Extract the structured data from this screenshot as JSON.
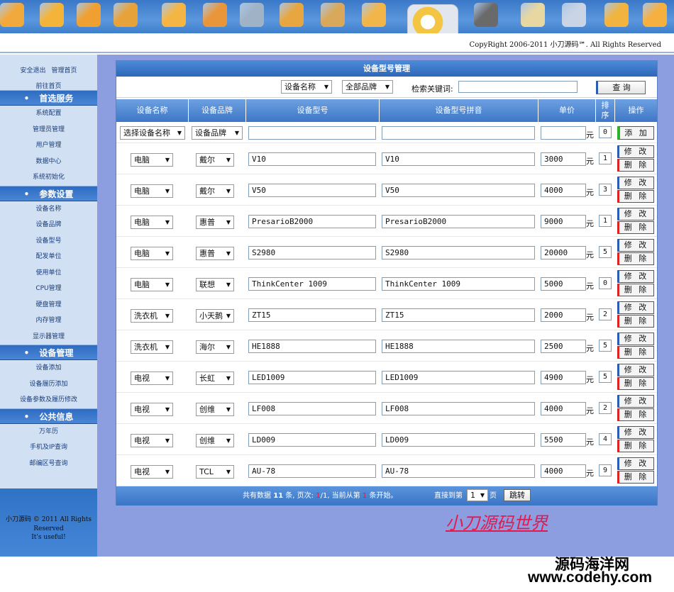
{
  "copyright": "CopyRight 2006-2011 小刀源码℠. All Rights Reserved",
  "toolbar_icons": [
    "home-icon",
    "tools-icon",
    "user-icon",
    "users-icon",
    "ai-icon",
    "briefcase-icon",
    "network-icon",
    "calculator-icon",
    "grid-icon",
    "image-edit-icon",
    "featured-icon",
    "clapperboard-icon",
    "package-icon",
    "calendar-icon",
    "coupon-icon",
    "clock-icon"
  ],
  "sidebar": {
    "quick_links": [
      "安全退出",
      "管理首页"
    ],
    "front_link": "前往首页",
    "sections": [
      {
        "title": "首选服务",
        "items": [
          "系统配置",
          "管理员管理",
          "用户管理",
          "数据中心",
          "系统初始化"
        ]
      },
      {
        "title": "参数设置",
        "items": [
          "设备名称",
          "设备品牌",
          "设备型号",
          "配发单位",
          "使用单位",
          "CPU管理",
          "硬盘管理",
          "内存管理",
          "显示器管理"
        ]
      },
      {
        "title": "设备管理",
        "items": [
          "设备添加",
          "设备履历添加",
          "设备参数及履历修改"
        ]
      },
      {
        "title": "公共信息",
        "items": [
          "万年历",
          "手机及IP查询",
          "邮编区号查询"
        ]
      }
    ],
    "footer": [
      "小刀源码 © 2011 All Rights",
      "Reserved",
      "It's useful!"
    ]
  },
  "panel": {
    "title": "设备型号管理",
    "filter_name": "设备名称",
    "filter_brand": "全部品牌",
    "search_label": "检索关键词:",
    "search_value": "",
    "search_button": "查 询"
  },
  "columns": [
    "设备名称",
    "设备品牌",
    "设备型号",
    "设备型号拼音",
    "单价",
    "排序",
    "操作"
  ],
  "add_row": {
    "name": "选择设备名称",
    "brand": "设备品牌",
    "model": "",
    "pinyin": "",
    "price": "",
    "unit": "元",
    "order": "0",
    "button": "添 加"
  },
  "rows": [
    {
      "name": "电脑",
      "brand": "戴尔",
      "model": "V10",
      "pinyin": "V10",
      "price": "3000",
      "order": "1"
    },
    {
      "name": "电脑",
      "brand": "戴尔",
      "model": "V50",
      "pinyin": "V50",
      "price": "4000",
      "order": "3"
    },
    {
      "name": "电脑",
      "brand": "惠普",
      "model": "PresarioB2000",
      "pinyin": "PresarioB2000",
      "price": "9000",
      "order": "1"
    },
    {
      "name": "电脑",
      "brand": "惠普",
      "model": "S2980",
      "pinyin": "S2980",
      "price": "20000",
      "order": "5"
    },
    {
      "name": "电脑",
      "brand": "联想",
      "model": "ThinkCenter 1009",
      "pinyin": "ThinkCenter 1009",
      "price": "5000",
      "order": "0"
    },
    {
      "name": "洗衣机",
      "brand": "小天鹅",
      "model": "ZT15",
      "pinyin": "ZT15",
      "price": "2000",
      "order": "2"
    },
    {
      "name": "洗衣机",
      "brand": "海尔",
      "model": "HE1888",
      "pinyin": "HE1888",
      "price": "2500",
      "order": "5"
    },
    {
      "name": "电视",
      "brand": "长虹",
      "model": "LED1009",
      "pinyin": "LED1009",
      "price": "4900",
      "order": "5"
    },
    {
      "name": "电视",
      "brand": "创维",
      "model": "LF008",
      "pinyin": "LF008",
      "price": "4000",
      "order": "2"
    },
    {
      "name": "电视",
      "brand": "创维",
      "model": "LD009",
      "pinyin": "LD009",
      "price": "5500",
      "order": "4"
    },
    {
      "name": "电视",
      "brand": "TCL",
      "model": "AU-78",
      "pinyin": "AU-78",
      "price": "4000",
      "order": "9"
    }
  ],
  "row_unit": "元",
  "edit_label": "修 改",
  "delete_label": "删 除",
  "pager": {
    "prefix": "共有数据",
    "total": "11",
    "total_suffix": "条, 页次:",
    "page": "1",
    "page_sep": "/1, 当前从第",
    "start": "1",
    "start_suffix": "条开始。",
    "jump_label": "直接到第",
    "jump_value": "1",
    "page_unit": "页",
    "jump_button": "跳转"
  },
  "watermark_site": "小刀源码世界",
  "watermark_cn": "源码海洋网",
  "watermark_url": "www.codehy.com"
}
